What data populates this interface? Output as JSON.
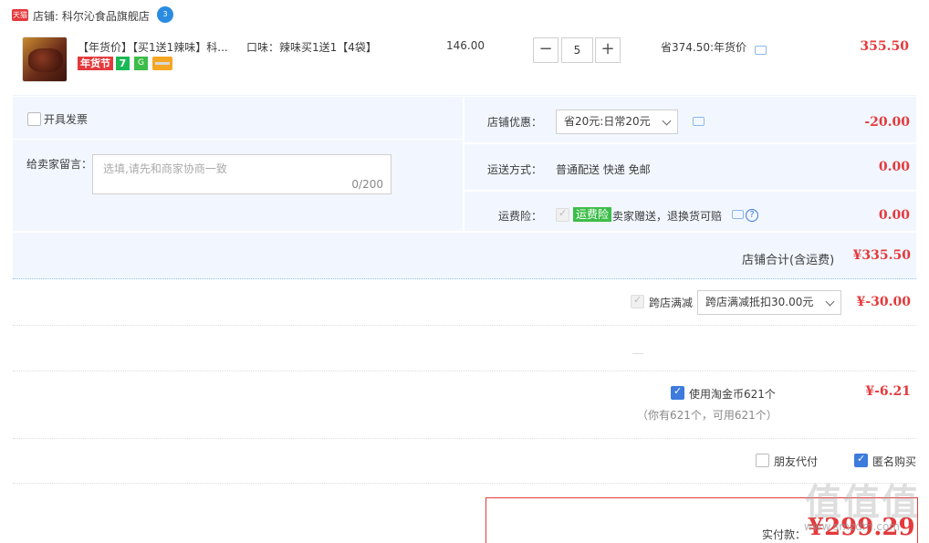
{
  "store": {
    "platform_badge": "天猫",
    "name_label": "店铺: 科尔沁食品旗舰店",
    "wangwang_label": "3"
  },
  "item": {
    "title": "【年货价】【买1送1辣味】科...",
    "badges": {
      "nianhuojie": "年货节",
      "seven_day": "7",
      "guarantee": "G"
    },
    "sku": "口味：辣味买1送1【4袋】",
    "unit_price": "146.00",
    "quantity": "5",
    "minus_symbol": "−",
    "plus_symbol": "+",
    "discount_text": "省374.50:年货价",
    "subtotal": "355.50"
  },
  "order": {
    "invoice_label": "开具发票",
    "message_label": "给卖家留言：",
    "message_placeholder": "选填,请先和商家协商一致",
    "message_count": "0/200",
    "shop_discount_label": "店铺优惠：",
    "shop_discount_selected": "省20元:日常20元",
    "shop_discount_amount": "-20.00",
    "shipping_label": "运送方式：",
    "shipping_value": "普通配送 快递 免邮",
    "shipping_amount": "0.00",
    "insurance_label": "运费险：",
    "insurance_tag": "运费险",
    "insurance_text": "卖家赠送，退换货可赔",
    "insurance_amount": "0.00",
    "store_total_label": "店铺合计(含运费)",
    "store_total": "¥335.50"
  },
  "cross_store": {
    "label": "跨店满减",
    "selected": "跨店满减抵扣30.00元",
    "amount": "¥-30.00"
  },
  "coins": {
    "label": "使用淘金币621个",
    "note": "（你有621个，可用621个）",
    "amount": "¥-6.21"
  },
  "options": {
    "friend_pay": "朋友代付",
    "anonymous": "匿名购买"
  },
  "payment": {
    "label": "实付款：",
    "amount": "¥299.29"
  },
  "watermark": {
    "logo": "值值值",
    "url": "www.smzdm.com"
  }
}
